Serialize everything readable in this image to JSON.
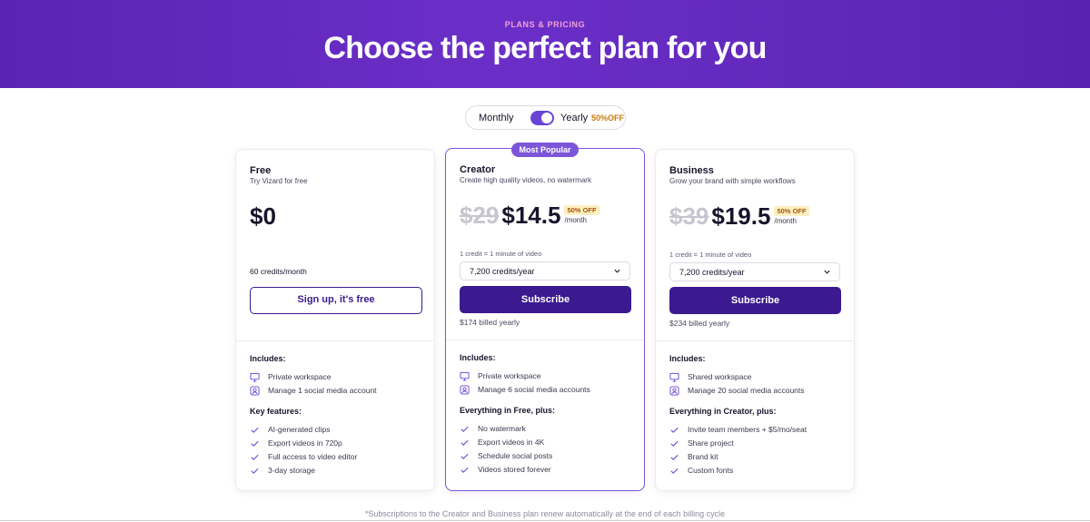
{
  "hero": {
    "kicker": "PLANS & PRICING",
    "title": "Choose the perfect plan for you"
  },
  "billing_toggle": {
    "monthly": "Monthly",
    "yearly": "Yearly",
    "discount": "50%OFF",
    "selected": "Yearly"
  },
  "plans": [
    {
      "name": "Free",
      "subtitle": "Try Vizard for free",
      "price": "$0",
      "credits": "60 credits/month",
      "cta": "Sign up, it's free",
      "includes_title": "Includes:",
      "includes": [
        {
          "icon": "monitor-icon",
          "text": "Private workspace"
        },
        {
          "icon": "user-square-icon",
          "text": "Manage 1 social media account"
        }
      ],
      "features_title": "Key features:",
      "features": [
        "AI-generated clips",
        "Export videos in 720p",
        "Full access to video editor",
        "3-day storage"
      ]
    },
    {
      "name": "Creator",
      "subtitle": "Create high quality videos, no watermark",
      "badge": "Most Popular",
      "old_price": "$29",
      "price": "$14.5",
      "off": "50% OFF",
      "per": "/month",
      "credit_note": "1 credit = 1 minute of video",
      "credit_select": "7,200 credits/year",
      "cta": "Subscribe",
      "billed": "$174 billed yearly",
      "includes_title": "Includes:",
      "includes": [
        {
          "icon": "monitor-icon",
          "text": "Private workspace"
        },
        {
          "icon": "user-square-icon",
          "text": "Manage 6 social media accounts"
        }
      ],
      "features_title": "Everything in Free, plus:",
      "features": [
        "No watermark",
        "Export videos in 4K",
        "Schedule social posts",
        "Videos stored forever"
      ]
    },
    {
      "name": "Business",
      "subtitle": "Grow your brand with simple workflows",
      "old_price": "$39",
      "price": "$19.5",
      "off": "50% OFF",
      "per": "/month",
      "credit_note": "1 credit = 1 minute of video",
      "credit_select": "7,200 credits/year",
      "cta": "Subscribe",
      "billed": "$234 billed yearly",
      "includes_title": "Includes:",
      "includes": [
        {
          "icon": "monitor-icon",
          "text": "Shared workspace"
        },
        {
          "icon": "user-square-icon",
          "text": "Manage 20 social media accounts"
        }
      ],
      "features_title": "Everything in Creator, plus:",
      "features": [
        "Invite team members + $5/mo/seat",
        "Share project",
        "Brand kit",
        "Custom fonts"
      ]
    }
  ],
  "footnote": "*Subscriptions to the Creator and Business plan renew automatically at the end of each billing cycle",
  "colors": {
    "hero": "#5b23b4",
    "accent": "#7c56d8",
    "button": "#3b1a8f",
    "discount": "#fcefc2"
  }
}
